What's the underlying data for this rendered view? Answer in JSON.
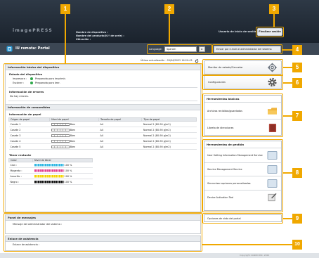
{
  "header": {
    "brand": "imagePRESS",
    "device_name_label": "Nombre de dispositivo :",
    "product_name_label": "Nombre del producto(N.º de serie) :",
    "location_label": "Ubicación :",
    "login_user": "Usuario de inicio de sesión :  Administrator",
    "logout": "Finalizar sesión"
  },
  "titlebar": {
    "title": "IU remota: Portal",
    "language_label": "Language:",
    "language_value": "Spanish",
    "language_go": "▸",
    "mail_button": "Enviar por e-mail al administrador del sistema"
  },
  "status_stamp": "Última actualización : 20/06/2022 16:20:43",
  "basic_info": {
    "title": "Información básica del dispositivo",
    "device_status_title": "Estado del dispositivo",
    "printer_label": "Impresora :",
    "printer_status": "Preparada para imprimir.",
    "scanner_label": "Escáner :",
    "scanner_status": "Preparada para leer.",
    "errors_title": "Información de errores",
    "errors_text": "No hay errores."
  },
  "consumables": {
    "title": "Información de consumibles",
    "paper_title": "Información de papel",
    "paper_headers": [
      "Origen de papel",
      "Nivel de papel",
      "Tamaño de papel",
      "Tipo de papel"
    ],
    "paper_rows": [
      {
        "source": "Casete 1",
        "level": "Bien",
        "size": "A4",
        "type": "Normal 2 (80-90 g/m2)"
      },
      {
        "source": "Casete 2",
        "level": "Bien",
        "size": "A4",
        "type": "Normal 2 (80-90 g/m2)"
      },
      {
        "source": "Casete 3",
        "level": "Bien",
        "size": "A4",
        "type": "Normal 2 (80-90 g/m2)"
      },
      {
        "source": "Casete 4",
        "level": "Bien",
        "size": "A4",
        "type": "Normal 2 (80-90 g/m2)"
      },
      {
        "source": "Casete 5",
        "level": "Bien",
        "size": "A4",
        "type": "Normal 2 (80-90 g/m2)"
      }
    ],
    "toner_title": "Tóner restante",
    "toner_headers": [
      "Color",
      "Nivel de tóner"
    ],
    "toner_rows": [
      {
        "color": "Cian :",
        "level": "100 %",
        "hex": "#2fb7e3",
        "fraction": 1.0
      },
      {
        "color": "Magenta :",
        "level": "100 %",
        "hex": "#e23c8e",
        "fraction": 1.0
      },
      {
        "color": "Amarillo :",
        "level": "100 %",
        "hex": "#f5d500",
        "fraction": 1.0
      },
      {
        "color": "Negro :",
        "level": "100 %",
        "hex": "#111111",
        "fraction": 1.0
      }
    ]
  },
  "messages": {
    "title": "Panel de mensajes",
    "text": "Mensaje del administrador del sistema :"
  },
  "support": {
    "title": "Enlace de asistencia",
    "text": "Enlace de asistencia :"
  },
  "right": {
    "status_monitor": "Monitor de estado/Cancelar",
    "settings": "Configuración",
    "basic_tools_title": "Herramientas básicas",
    "basic_tools": [
      "Archivos recibidos/guardados",
      "Libreta de direcciones"
    ],
    "mgmt_tools_title": "Herramientas de gestión",
    "mgmt_tools": [
      "User Setting Information Management Service",
      "Service Management Service",
      "Sincronizar opciones personalizadas",
      "Device Activation Tool"
    ],
    "portal_options": "Opciones de vista del portal"
  },
  "badges": [
    "1",
    "2",
    "3",
    "4",
    "5",
    "6",
    "7",
    "8",
    "9",
    "10"
  ],
  "footer": {
    "copyright": "Copyright CANON INC. 2022"
  },
  "colors": {
    "accent": "#f0a800",
    "header": "#2e3946",
    "status_ok": "#2ea84a"
  }
}
